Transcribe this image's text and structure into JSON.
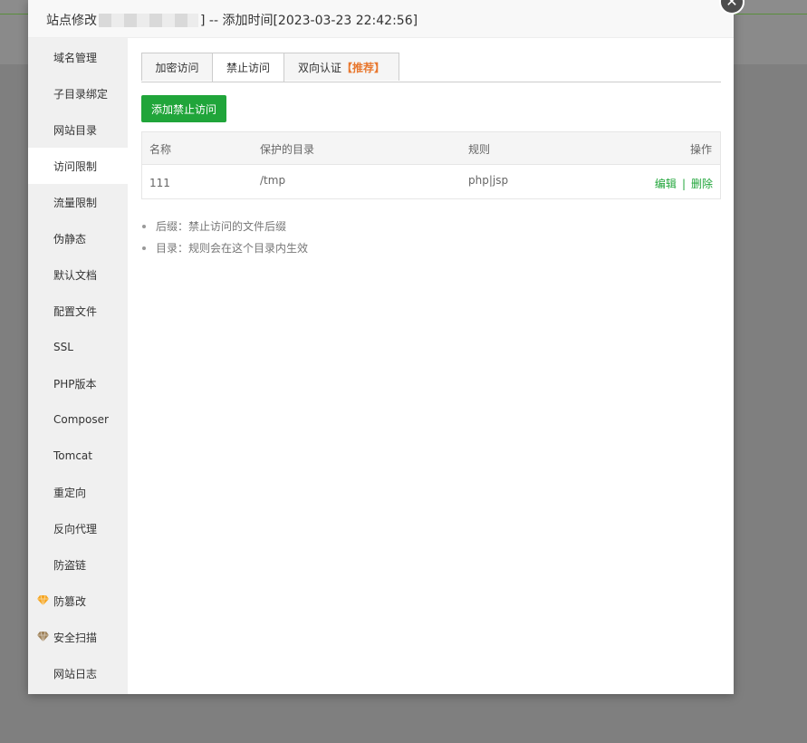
{
  "window": {
    "title_prefix": "站点修改",
    "title_suffix": "] -- 添加时间[2023-03-23 22:42:56]",
    "close_glyph": "✕"
  },
  "sidebar": {
    "active_index": 3,
    "items": [
      {
        "label": "域名管理",
        "icon": ""
      },
      {
        "label": "子目录绑定",
        "icon": ""
      },
      {
        "label": "网站目录",
        "icon": ""
      },
      {
        "label": "访问限制",
        "icon": ""
      },
      {
        "label": "流量限制",
        "icon": ""
      },
      {
        "label": "伪静态",
        "icon": ""
      },
      {
        "label": "默认文档",
        "icon": ""
      },
      {
        "label": "配置文件",
        "icon": ""
      },
      {
        "label": "SSL",
        "icon": ""
      },
      {
        "label": "PHP版本",
        "icon": ""
      },
      {
        "label": "Composer",
        "icon": ""
      },
      {
        "label": "Tomcat",
        "icon": ""
      },
      {
        "label": "重定向",
        "icon": ""
      },
      {
        "label": "反向代理",
        "icon": ""
      },
      {
        "label": "防盗链",
        "icon": ""
      },
      {
        "label": "防篡改",
        "icon": "gem-gold-icon"
      },
      {
        "label": "安全扫描",
        "icon": "gem-bronze-icon"
      },
      {
        "label": "网站日志",
        "icon": ""
      }
    ]
  },
  "tabs": [
    {
      "label": "加密访问",
      "badge": ""
    },
    {
      "label": "禁止访问",
      "badge": ""
    },
    {
      "label": "双向认证",
      "badge": "【推荐】"
    }
  ],
  "active_tab": 1,
  "toolbar": {
    "add_label": "添加禁止访问"
  },
  "table": {
    "headers": {
      "name": "名称",
      "dir": "保护的目录",
      "rule": "规则",
      "op": "操作"
    },
    "rows": [
      {
        "name": "111",
        "dir": "/tmp",
        "rule": "php|jsp",
        "edit": "编辑",
        "sep": "|",
        "delete": "删除"
      }
    ]
  },
  "tips": [
    "后缀：禁止访问的文件后缀",
    "目录：规则会在这个目录内生效"
  ],
  "colors": {
    "accent": "#20a53a",
    "recommend": "#e8772e",
    "gem_gold": "#f5a623",
    "gem_bronze": "#a0845c"
  }
}
